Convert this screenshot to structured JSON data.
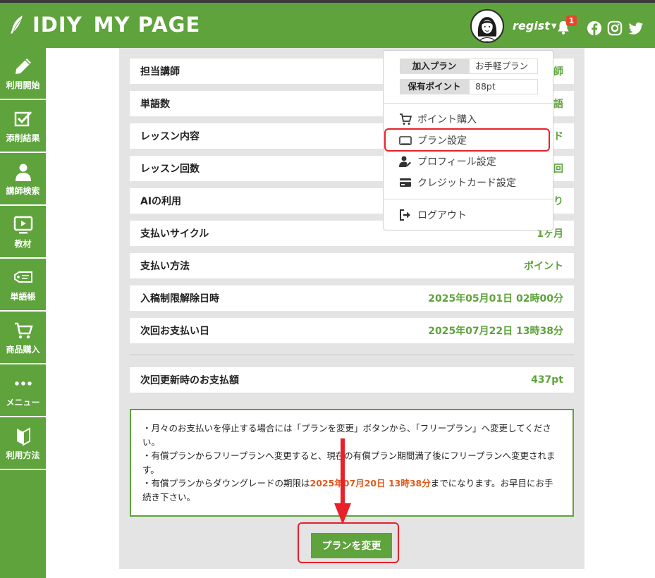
{
  "header": {
    "brand": "IDIY",
    "title": "MY PAGE",
    "username": "regist",
    "notification_count": "1",
    "colors": {
      "primary": "#5ea33c",
      "highlight": "#e8202a",
      "accent_text": "#e05a1e"
    },
    "icons": [
      "quill-icon",
      "bell-icon",
      "facebook-icon",
      "instagram-icon",
      "twitter-icon"
    ]
  },
  "sidebar": {
    "items": [
      {
        "label": "利用開始",
        "icon": "pencil-icon"
      },
      {
        "label": "添削結果",
        "icon": "checkbox-icon"
      },
      {
        "label": "講師検索",
        "icon": "person-icon"
      },
      {
        "label": "教材",
        "icon": "video-icon"
      },
      {
        "label": "単語帳",
        "icon": "tag-icon"
      },
      {
        "label": "商品購入",
        "icon": "cart-icon"
      },
      {
        "label": "メニュー",
        "icon": "dots-icon"
      },
      {
        "label": "利用方法",
        "icon": "beginner-mark-icon"
      }
    ]
  },
  "plan_details": {
    "rows": [
      {
        "label": "担当講師",
        "value": "師"
      },
      {
        "label": "単語数",
        "value": "語"
      },
      {
        "label": "レッスン内容",
        "value": "ド"
      },
      {
        "label": "レッスン回数",
        "value": "回"
      },
      {
        "label": "AIの利用",
        "value": "り"
      },
      {
        "label": "支払いサイクル",
        "value": "1ヶ月"
      },
      {
        "label": "支払い方法",
        "value": "ポイント"
      },
      {
        "label": "入稿制限解除日時",
        "value": "2025年05月01日 02時00分"
      },
      {
        "label": "次回お支払い日",
        "value": "2025年07月22日 13時38分"
      }
    ],
    "next_amount": {
      "label": "次回更新時のお支払額",
      "value": "437pt"
    }
  },
  "notice": {
    "line1": "・月々のお支払いを停止する場合には「プランを変更」ボタンから、「フリープラン」へ変更してください。",
    "line2": "・有償プランからフリープランへ変更すると、現在の有償プラン期間満了後にフリープランへ変更されます。",
    "line3_pre": "・有償プランからダウングレードの期限は",
    "line3_date": "2025年07月20日 13時38分",
    "line3_post": "までになります。お早目にお手続き下さい。"
  },
  "change_plan_button": "プランを変更",
  "dropdown": {
    "plan_label": "加入プラン",
    "plan_value": "お手軽プラン",
    "points_label": "保有ポイント",
    "points_value": "88pt",
    "items": [
      {
        "label": "ポイント購入",
        "icon": "cart-icon"
      },
      {
        "label": "プラン設定",
        "icon": "card-outline-icon"
      },
      {
        "label": "プロフィール設定",
        "icon": "user-edit-icon"
      },
      {
        "label": "クレジットカード設定",
        "icon": "credit-card-icon"
      }
    ],
    "logout": {
      "label": "ログアウト",
      "icon": "logout-icon"
    }
  }
}
